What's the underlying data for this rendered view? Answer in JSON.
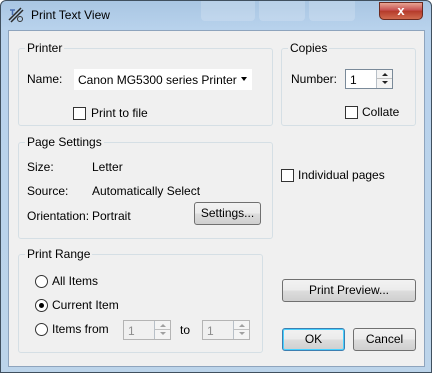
{
  "window": {
    "title": "Print Text View",
    "close_label": "x"
  },
  "printer": {
    "group_label": "Printer",
    "name_label": "Name:",
    "name_value": "Canon MG5300 series Printer",
    "print_to_file_label": "Print to file",
    "print_to_file_checked": false
  },
  "copies": {
    "group_label": "Copies",
    "number_label": "Number:",
    "number_value": "1",
    "collate_label": "Collate",
    "collate_checked": false
  },
  "page_settings": {
    "group_label": "Page Settings",
    "size_label": "Size:",
    "size_value": "Letter",
    "source_label": "Source:",
    "source_value": "Automatically Select",
    "orientation_label": "Orientation:",
    "orientation_value": "Portrait",
    "settings_button": "Settings..."
  },
  "individual_pages": {
    "label": "Individual pages",
    "checked": false
  },
  "print_range": {
    "group_label": "Print Range",
    "all_items_label": "All Items",
    "current_item_label": "Current Item",
    "items_from_label": "Items from",
    "from_value": "1",
    "to_label": "to",
    "to_value": "1",
    "selected": "Current Item"
  },
  "buttons": {
    "print_preview": "Print Preview...",
    "ok": "OK",
    "cancel": "Cancel"
  }
}
